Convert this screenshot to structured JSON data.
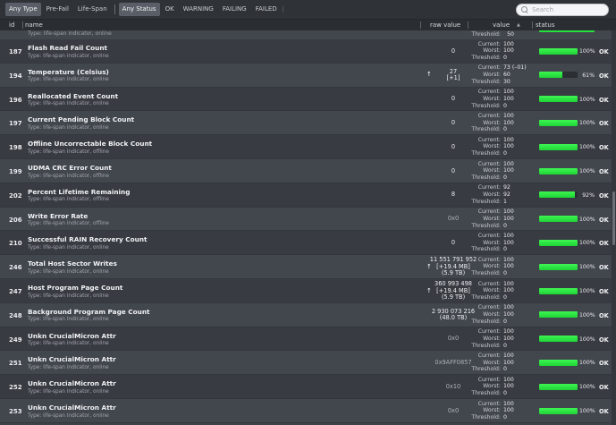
{
  "filters": {
    "type_options": [
      "Any Type",
      "Pre-Fail",
      "Life-Span"
    ],
    "type_selected": "Any Type",
    "status_options": [
      "Any Status",
      "OK",
      "WARNING",
      "FAILING",
      "FAILED"
    ],
    "status_selected": "Any Status",
    "trailing_separator": "|"
  },
  "search": {
    "placeholder": "Search"
  },
  "columns": {
    "id": "id",
    "name": "name",
    "raw": "raw value",
    "value": "value",
    "status": "status"
  },
  "value_labels": {
    "current": "Current:",
    "worst": "Worst:",
    "threshold": "Threshold:"
  },
  "partial_row": {
    "type": "Type: life-span indicator, online",
    "threshold": "50"
  },
  "rows": [
    {
      "id": "187",
      "name": "Flash Read Fail Count",
      "type": "Type: life-span indicator, online",
      "raw": [
        "0"
      ],
      "raw_style": "dec",
      "arrow": "",
      "current": "100",
      "worst": "100",
      "threshold": "0",
      "pct": 100,
      "pct_label": "100%",
      "status": "OK"
    },
    {
      "id": "194",
      "name": "Temperature (Celsius)",
      "type": "Type: life-span indicator, online",
      "raw": [
        "27",
        "[+1]"
      ],
      "raw_style": "dec",
      "arrow": "↑",
      "current": "73 (–01)",
      "worst": "60",
      "threshold": "30",
      "pct": 61,
      "pct_label": "61%",
      "status": "OK"
    },
    {
      "id": "196",
      "name": "Reallocated Event Count",
      "type": "Type: life-span indicator, online",
      "raw": [
        "0"
      ],
      "raw_style": "dec",
      "arrow": "",
      "current": "100",
      "worst": "100",
      "threshold": "0",
      "pct": 100,
      "pct_label": "100%",
      "status": "OK"
    },
    {
      "id": "197",
      "name": "Current Pending Block Count",
      "type": "Type: life-span indicator, online",
      "raw": [
        "0"
      ],
      "raw_style": "dec",
      "arrow": "",
      "current": "100",
      "worst": "100",
      "threshold": "0",
      "pct": 100,
      "pct_label": "100%",
      "status": "OK"
    },
    {
      "id": "198",
      "name": "Offline Uncorrectable Block Count",
      "type": "Type: life-span indicator, offline",
      "raw": [
        "0"
      ],
      "raw_style": "dec",
      "arrow": "",
      "current": "100",
      "worst": "100",
      "threshold": "0",
      "pct": 100,
      "pct_label": "100%",
      "status": "OK"
    },
    {
      "id": "199",
      "name": "UDMA CRC Error Count",
      "type": "Type: life-span indicator, offline",
      "raw": [
        "0"
      ],
      "raw_style": "dec",
      "arrow": "",
      "current": "100",
      "worst": "100",
      "threshold": "0",
      "pct": 100,
      "pct_label": "100%",
      "status": "OK"
    },
    {
      "id": "202",
      "name": "Percent Lifetime Remaining",
      "type": "Type: life-span indicator, offline",
      "raw": [
        "8"
      ],
      "raw_style": "dec",
      "arrow": "",
      "current": "92",
      "worst": "92",
      "threshold": "1",
      "pct": 92,
      "pct_label": "92%",
      "status": "OK"
    },
    {
      "id": "206",
      "name": "Write Error Rate",
      "type": "Type: life-span indicator, offline",
      "raw": [
        "0x0"
      ],
      "raw_style": "hex",
      "arrow": "",
      "current": "100",
      "worst": "100",
      "threshold": "0",
      "pct": 100,
      "pct_label": "100%",
      "status": "OK"
    },
    {
      "id": "210",
      "name": "Successful RAIN Recovery Count",
      "type": "Type: life-span indicator, online",
      "raw": [
        "0"
      ],
      "raw_style": "dec",
      "arrow": "",
      "current": "100",
      "worst": "100",
      "threshold": "0",
      "pct": 100,
      "pct_label": "100%",
      "status": "OK"
    },
    {
      "id": "246",
      "name": "Total Host Sector Writes",
      "type": "Type: life-span indicator, online",
      "raw": [
        "11 551 791 952",
        "[+19.4 MB]",
        "(5.9 TB)"
      ],
      "raw_style": "dec",
      "arrow": "↑",
      "current": "100",
      "worst": "100",
      "threshold": "0",
      "pct": 100,
      "pct_label": "100%",
      "status": "OK"
    },
    {
      "id": "247",
      "name": "Host Program Page Count",
      "type": "Type: life-span indicator, online",
      "raw": [
        "360 993 498",
        "[+19.4 MB]",
        "(5.9 TB)"
      ],
      "raw_style": "dec",
      "arrow": "↑",
      "current": "100",
      "worst": "100",
      "threshold": "0",
      "pct": 100,
      "pct_label": "100%",
      "status": "OK"
    },
    {
      "id": "248",
      "name": "Background Program Page Count",
      "type": "Type: life-span indicator, online",
      "raw": [
        "2 930 073 216",
        "(48.0 TB)"
      ],
      "raw_style": "dec",
      "arrow": "",
      "current": "100",
      "worst": "100",
      "threshold": "0",
      "pct": 100,
      "pct_label": "100%",
      "status": "OK"
    },
    {
      "id": "249",
      "name": "Unkn CrucialMicron Attr",
      "type": "Type: life-span indicator, online",
      "raw": [
        "0x0"
      ],
      "raw_style": "hex",
      "arrow": "",
      "current": "100",
      "worst": "100",
      "threshold": "0",
      "pct": 100,
      "pct_label": "100%",
      "status": "OK"
    },
    {
      "id": "251",
      "name": "Unkn CrucialMicron Attr",
      "type": "Type: life-span indicator, online",
      "raw": [
        "0x9AFF0857"
      ],
      "raw_style": "hex",
      "arrow": "",
      "current": "100",
      "worst": "100",
      "threshold": "0",
      "pct": 100,
      "pct_label": "100%",
      "status": "OK"
    },
    {
      "id": "252",
      "name": "Unkn CrucialMicron Attr",
      "type": "Type: life-span indicator, online",
      "raw": [
        "0x10"
      ],
      "raw_style": "hex",
      "arrow": "",
      "current": "100",
      "worst": "100",
      "threshold": "0",
      "pct": 100,
      "pct_label": "100%",
      "status": "OK"
    },
    {
      "id": "253",
      "name": "Unkn CrucialMicron Attr",
      "type": "Type: life-span indicator, online",
      "raw": [
        "0x0"
      ],
      "raw_style": "hex",
      "arrow": "",
      "current": "100",
      "worst": "100",
      "threshold": "0",
      "pct": 100,
      "pct_label": "100%",
      "status": "OK"
    }
  ],
  "colors": {
    "bar_green": "#27e13f",
    "background": "#3d4148"
  }
}
